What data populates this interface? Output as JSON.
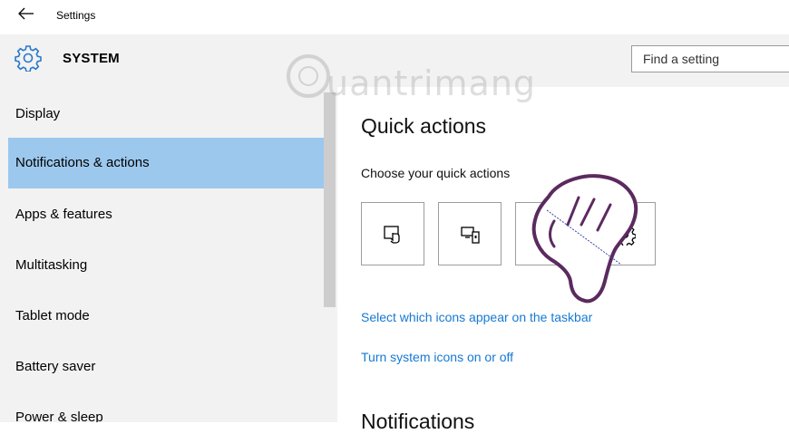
{
  "window": {
    "title": "Settings",
    "back_icon": "back-arrow-icon"
  },
  "header": {
    "icon": "gear-icon",
    "title": "SYSTEM",
    "search": {
      "placeholder": "Find a setting",
      "value": ""
    }
  },
  "sidebar": {
    "items": [
      {
        "label": "Display",
        "selected": false
      },
      {
        "label": "Notifications & actions",
        "selected": true
      },
      {
        "label": "Apps & features",
        "selected": false
      },
      {
        "label": "Multitasking",
        "selected": false
      },
      {
        "label": "Tablet mode",
        "selected": false
      },
      {
        "label": "Battery saver",
        "selected": false
      },
      {
        "label": "Power & sleep",
        "selected": false
      }
    ],
    "selected_color": "#9cc8ee"
  },
  "main": {
    "section_title": "Quick actions",
    "subtitle": "Choose your quick actions",
    "quick_actions": [
      {
        "icon": "tablet-mode-icon"
      },
      {
        "icon": "connect-icon"
      },
      {
        "icon": "note-icon"
      },
      {
        "icon": "settings-icon"
      }
    ],
    "links": [
      "Select which icons appear on the taskbar",
      "Turn system icons on or off"
    ],
    "next_section_title": "Notifications",
    "link_color": "#1679d3"
  },
  "watermark": {
    "text": "uantrimang"
  }
}
